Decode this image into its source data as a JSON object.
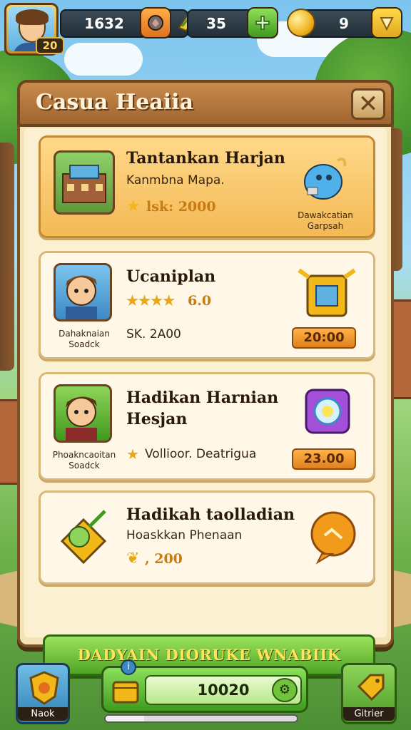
{
  "hud": {
    "level": "20",
    "resources": [
      {
        "name": "gems",
        "value": "1632",
        "icon": "gem-icon"
      },
      {
        "name": "energy",
        "value": "35",
        "icon": "energy-icon"
      },
      {
        "name": "coins",
        "value": "9",
        "icon": "coin-icon"
      }
    ]
  },
  "panel": {
    "title": "Casua Heaiia",
    "close_icon": "close-icon",
    "cards": [
      {
        "title": "Tantankan Harjan",
        "subtitle": "Kanmbna Mapa.",
        "stat": "lsk: 2000",
        "caption_line1": "Dawakcatian",
        "caption_line2": "Garpsah",
        "reward_icon": "blue-creature-icon"
      },
      {
        "title": "Ucaniplan",
        "stars": "★★★★",
        "stat": "6.0",
        "stat2": "SK. 2A00",
        "caption_line1": "Dahaknaian",
        "caption_line2": "Soadck",
        "price": "20:00",
        "reward_icon": "treasure-chest-icon"
      },
      {
        "title_line1": "Hadikan Harnian",
        "title_line2": "Hesjan",
        "stat": "Vollioor. Deatrigua",
        "caption_line1": "Phoakncaoitan",
        "caption_line2": "Soadck",
        "price": "23.00",
        "reward_icon": "magic-orb-icon"
      },
      {
        "title": "Hadikah taolladian",
        "subtitle": "Hoaskkan Phenaan",
        "stat": ", 200",
        "reward_icon": "golden-leaf-icon"
      }
    ],
    "claim_button": "DADYAIN DIORUKE WNABIIK"
  },
  "bottom": {
    "left_label": "Naok",
    "center_value": "10020",
    "center_progress": 0.2,
    "right_label": "Gitrier"
  },
  "colors": {
    "panel_bg": "#f6e4b8",
    "accent_green": "#4fa426",
    "accent_orange": "#e0801f",
    "frame_brown": "#7a5226"
  }
}
